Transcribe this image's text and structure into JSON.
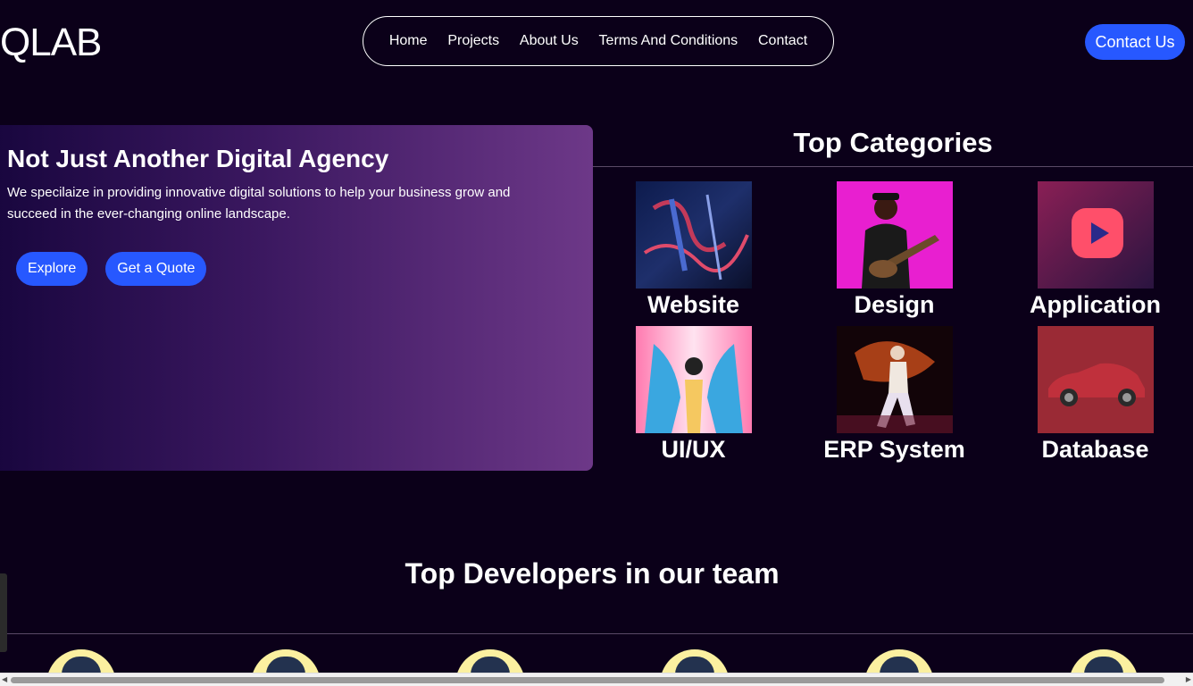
{
  "header": {
    "logo": "QLAB",
    "nav": [
      "Home",
      "Projects",
      "About Us",
      "Terms And Conditions",
      "Contact"
    ],
    "contact_button": "Contact Us"
  },
  "hero": {
    "title": "Not Just Another Digital Agency",
    "text": "We specilaize in providing innovative digital solutions to help your business grow and succeed in the ever-changing online landscape.",
    "explore": "Explore",
    "quote": "Get a Quote"
  },
  "categories": {
    "title": "Top Categories",
    "items": [
      "Website",
      "Design",
      "Application",
      "UI/UX",
      "ERP System",
      "Database"
    ]
  },
  "developers": {
    "title": "Top Developers in our team"
  },
  "colors": {
    "background": "#0b0019",
    "accent": "#2758ff",
    "avatar_bg": "#fbf0a0"
  }
}
